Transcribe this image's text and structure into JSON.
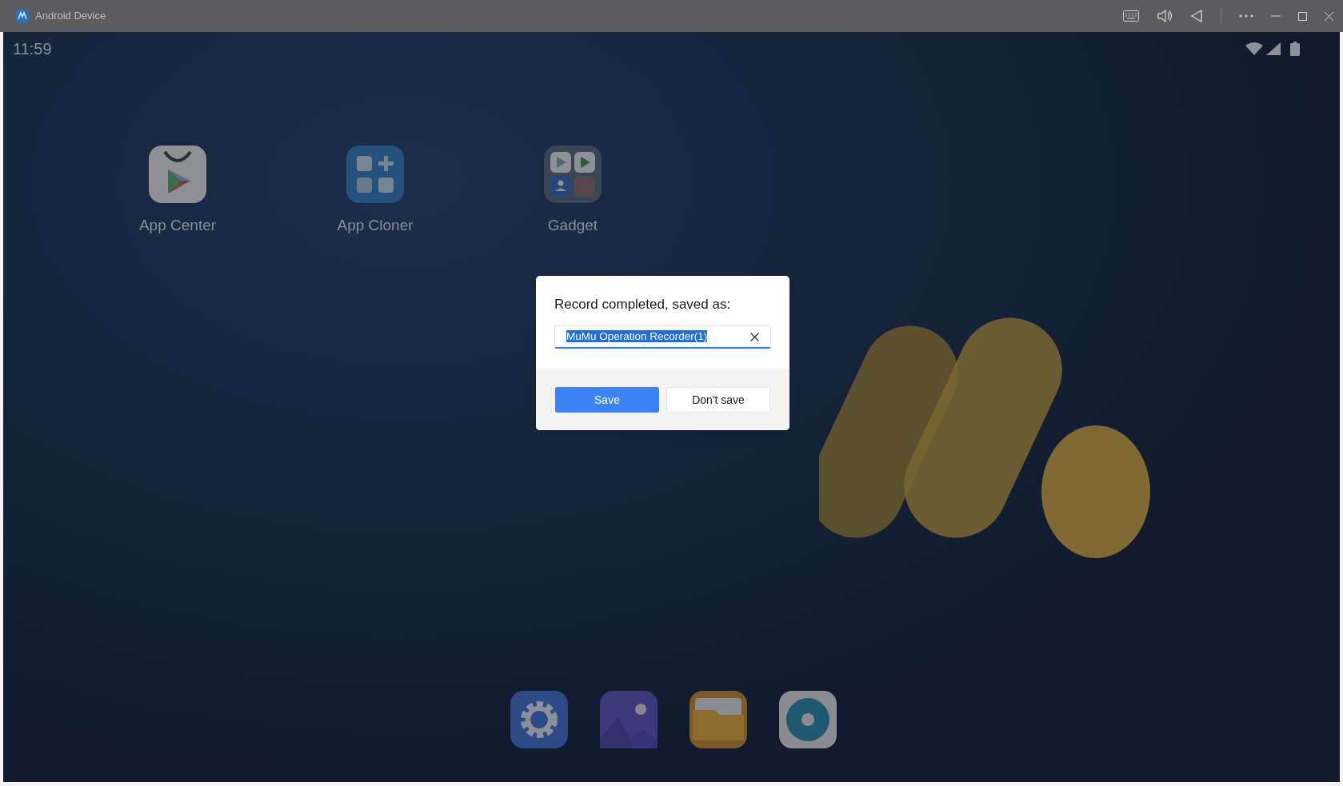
{
  "window": {
    "title": "Android Device"
  },
  "status_bar": {
    "time": "11:59"
  },
  "home_apps": [
    {
      "label": "App Center",
      "kind": "store"
    },
    {
      "label": "App Cloner",
      "kind": "cloner"
    },
    {
      "label": "Gadget",
      "kind": "folder"
    }
  ],
  "dock": [
    {
      "kind": "settings"
    },
    {
      "kind": "gallery"
    },
    {
      "kind": "files"
    },
    {
      "kind": "browser"
    }
  ],
  "dialog": {
    "message": "Record completed, saved as:",
    "field": {
      "value": "MuMu Operation Recorder(1)",
      "selected": true
    },
    "buttons": [
      {
        "label": "Save",
        "primary": true
      },
      {
        "label": "Don't save",
        "primary": false
      }
    ]
  }
}
